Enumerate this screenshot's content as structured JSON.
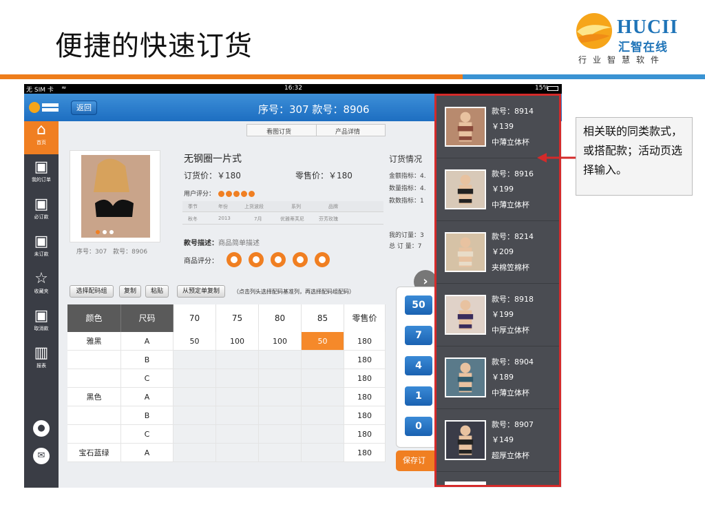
{
  "slide": {
    "title": "便捷的快速订货",
    "logo_text": "HUCII",
    "logo_cn": "汇智在线",
    "logo_sub": "行业智慧软件",
    "callout": "相关联的同类款式，或搭配款；活动页选择输入。",
    "colors": {
      "orange": "#ee7d1b",
      "blue": "#3a93d3",
      "highlight": "#d42a2a"
    }
  },
  "status_bar": {
    "carrier": "无 SIM 卡",
    "time": "16:32",
    "battery": "15%"
  },
  "navbar": {
    "back_label": "返回",
    "title": "序号：307 款号：8906"
  },
  "sidebar": {
    "items": [
      {
        "label": "首页",
        "icon": "home-icon"
      },
      {
        "label": "我的订单",
        "icon": "order-add-icon"
      },
      {
        "label": "必订款",
        "icon": "order-check-icon"
      },
      {
        "label": "未订款",
        "icon": "order-minus-icon"
      },
      {
        "label": "收藏夹",
        "icon": "star-icon"
      },
      {
        "label": "取消款",
        "icon": "order-cancel-icon"
      },
      {
        "label": "报表",
        "icon": "chart-icon"
      }
    ],
    "bottom_icons": [
      "user-icon",
      "message-icon"
    ]
  },
  "tabs": [
    "看图订货",
    "产品详情"
  ],
  "product": {
    "name": "无钢圈一片式",
    "order_price": "订货价：￥180",
    "retail_price": "零售价：￥180",
    "rating_label": "用户评分：",
    "rating": 5,
    "caption": "序号：307　款号：8906",
    "attr_headers": [
      "季节",
      "年份",
      "上货波段",
      "系列",
      "品牌"
    ],
    "attr_values": [
      "秋冬",
      "2013",
      "7月",
      "优雅蒂芙尼",
      "芬芳玫瑰"
    ],
    "desc_label": "款号描述：",
    "desc_value": "商品简单描述",
    "score_label": "商品评分：",
    "score": 5
  },
  "order_info": {
    "title": "订货情况",
    "lines": [
      "金额指标：4.",
      "数量指标：4.",
      "款数指标：1"
    ],
    "my_order": "我的订量：3",
    "total_order": "总 订 量：7"
  },
  "toolbar": {
    "buttons": [
      "选择配码组",
      "复制",
      "粘贴",
      "从预定单复制"
    ],
    "hint": "（点击列头选择配码基准列，再选择配码组配码）"
  },
  "grid": {
    "headers": [
      "颜色",
      "尺码",
      "70",
      "75",
      "80",
      "85",
      "零售价"
    ],
    "rows": [
      {
        "color": "雅黑",
        "size": "A",
        "cells": [
          "50",
          "100",
          "100",
          "50"
        ],
        "price": "180"
      },
      {
        "color": "",
        "size": "B",
        "cells": [
          "",
          "",
          "",
          ""
        ],
        "price": "180"
      },
      {
        "color": "",
        "size": "C",
        "cells": [
          "",
          "",
          "",
          ""
        ],
        "price": "180"
      },
      {
        "color": "黑色",
        "size": "A",
        "cells": [
          "",
          "",
          "",
          ""
        ],
        "price": "180"
      },
      {
        "color": "",
        "size": "B",
        "cells": [
          "",
          "",
          "",
          ""
        ],
        "price": "180"
      },
      {
        "color": "",
        "size": "C",
        "cells": [
          "",
          "",
          "",
          ""
        ],
        "price": "180"
      },
      {
        "color": "宝石蓝绿",
        "size": "A",
        "cells": [
          "",
          "",
          "",
          ""
        ],
        "price": "180"
      }
    ]
  },
  "keypad": {
    "keys": [
      "50",
      "7",
      "4",
      "1",
      "0"
    ],
    "save_label": "保存订"
  },
  "related": [
    {
      "style_no": "款号：8914",
      "price": "￥139",
      "type": "中薄立体杯"
    },
    {
      "style_no": "款号：8916",
      "price": "￥199",
      "type": "中薄立体杯"
    },
    {
      "style_no": "款号：8214",
      "price": "￥209",
      "type": "夹棉笠棉杯"
    },
    {
      "style_no": "款号：8918",
      "price": "￥199",
      "type": "中厚立体杯"
    },
    {
      "style_no": "款号：8904",
      "price": "￥189",
      "type": "中薄立体杯"
    },
    {
      "style_no": "款号：8907",
      "price": "￥149",
      "type": "超厚立体杯"
    }
  ]
}
